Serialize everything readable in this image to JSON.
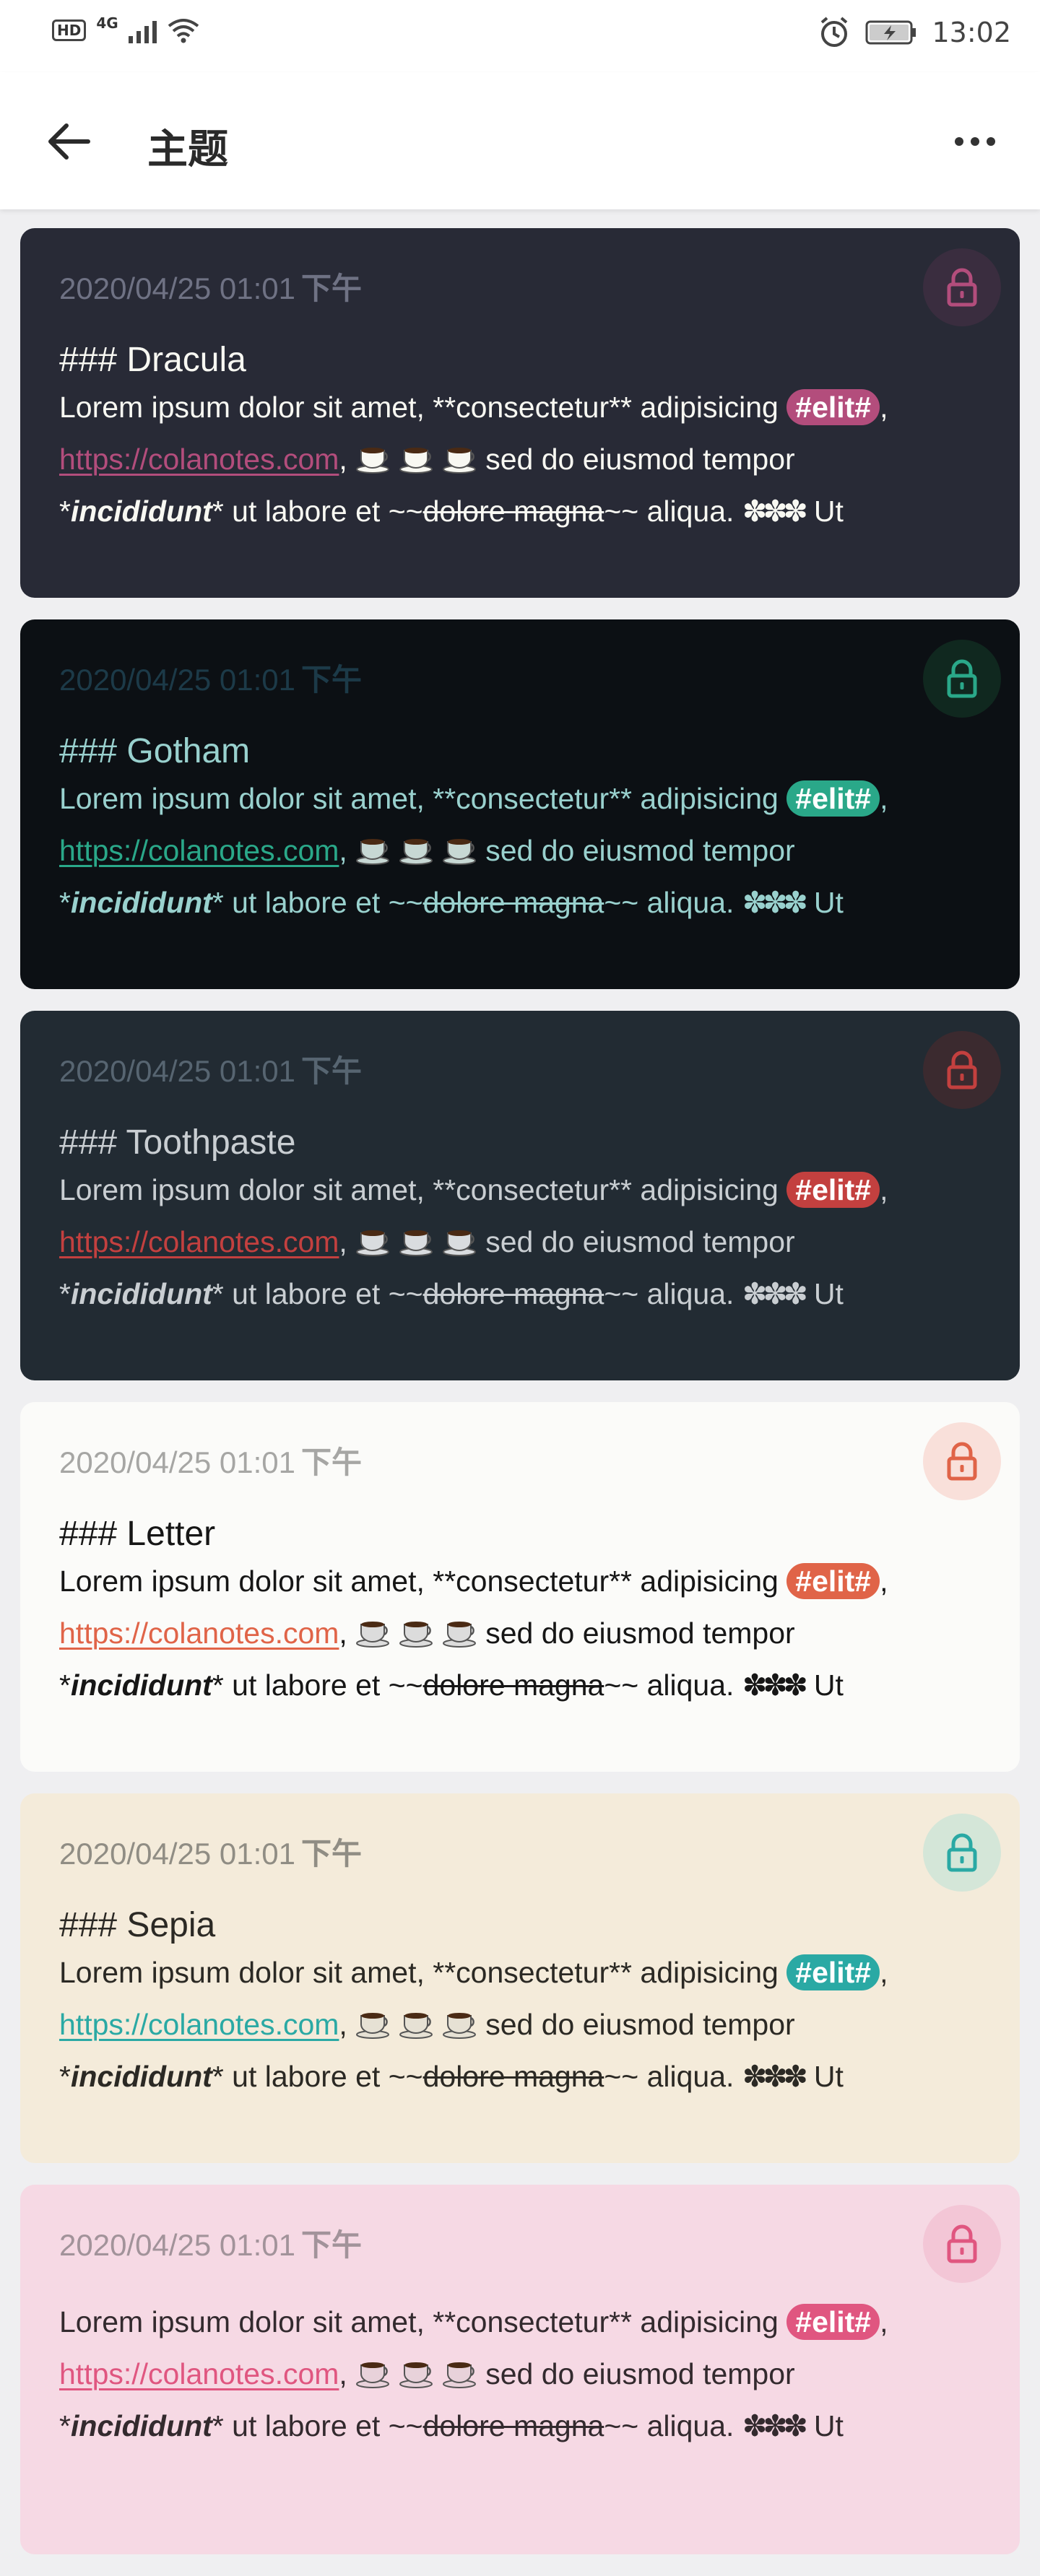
{
  "status_bar": {
    "hd": "HD",
    "network": "4G",
    "time": "13:02"
  },
  "header": {
    "title": "主题"
  },
  "shared": {
    "date": "2020/04/25 01:01",
    "date_suffix": "下午",
    "text1": "Lorem ipsum dolor sit amet, **consectetur** adipisicing",
    "tag": "#elit#",
    "comma": ",",
    "link": "https://colanotes.com",
    "text2": "sed do eiusmod tempor",
    "star_pre": "*",
    "em": "incididunt",
    "text3a": "* ut labore et ~~",
    "strike": "dolore magna",
    "text3b": "~~ aliqua.",
    "flowers": "✽✽✽",
    "text3c": "Ut"
  },
  "themes": [
    {
      "name": "### Dracula",
      "colors": {
        "bg": "#282a36",
        "date": "#6f7284",
        "text": "#f8f8f2",
        "accent": "#b34d7c",
        "lockbg": "#3a2d3f",
        "lock": "#b34d7c",
        "cup": "#f8f8f2"
      }
    },
    {
      "name": "### Gotham",
      "colors": {
        "bg": "#0c1014",
        "date": "#1c3a48",
        "text": "#99d1ce",
        "accent": "#2aa889",
        "lockbg": "#10281f",
        "lock": "#2aa889",
        "cup": "#c7d8d4"
      }
    },
    {
      "name": "### Toothpaste",
      "colors": {
        "bg": "#222b33",
        "date": "#576571",
        "text": "#c9ced2",
        "accent": "#c3403f",
        "lockbg": "#3b2a2f",
        "lock": "#c3403f",
        "cup": "#d9dcdf"
      }
    },
    {
      "name": "### Letter",
      "colors": {
        "bg": "#fbfbf9",
        "date": "#a6a6a4",
        "text": "#161616",
        "accent": "#e06448",
        "lockbg": "#f9e0da",
        "lock": "#e06448",
        "cup": "#dcdcdc"
      }
    },
    {
      "name": "### Sepia",
      "colors": {
        "bg": "#f4ebda",
        "date": "#908d84",
        "text": "#2b2924",
        "accent": "#2aa9a4",
        "lockbg": "#d4e6d8",
        "lock": "#2aa9a4",
        "cup": "#e6e1d4"
      }
    },
    {
      "name": "",
      "colors": {
        "bg": "#f6d9e4",
        "date": "#a2939a",
        "text": "#332a2e",
        "accent": "#e05680",
        "lockbg": "#f3c6d6",
        "lock": "#e05680",
        "cup": "#e8d2da"
      }
    }
  ]
}
